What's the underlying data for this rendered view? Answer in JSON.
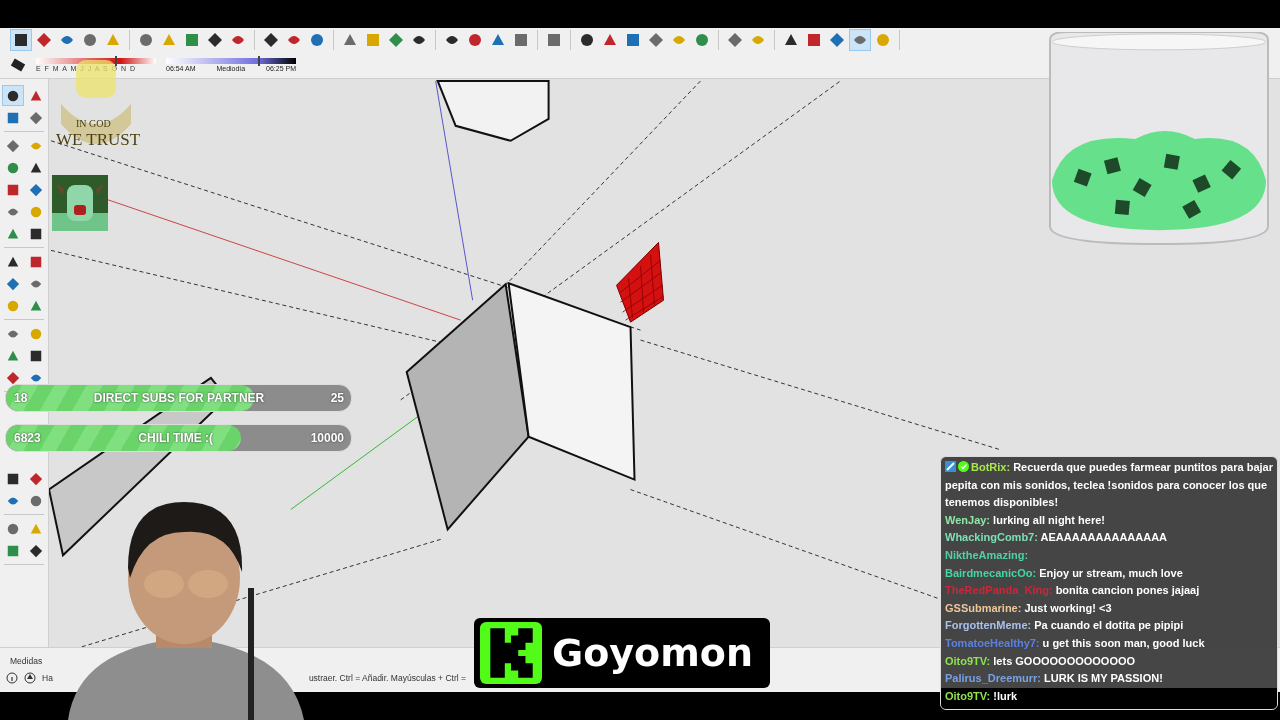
{
  "toolbar": {
    "groups": [
      [
        {
          "selected": true
        },
        {
          "selected": false
        },
        {
          "selected": false
        },
        {
          "selected": false
        },
        {
          "selected": false
        }
      ],
      [
        {
          "selected": false
        },
        {
          "selected": false
        },
        {
          "selected": false
        },
        {
          "selected": false
        },
        {
          "selected": false
        }
      ],
      [
        {
          "selected": false
        },
        {
          "selected": false
        },
        {
          "selected": false
        }
      ],
      [
        {
          "selected": false
        },
        {
          "selected": false
        },
        {
          "selected": false
        },
        {
          "selected": false
        }
      ],
      [
        {
          "selected": false
        },
        {
          "selected": false
        },
        {
          "selected": false
        },
        {
          "selected": false
        }
      ],
      [
        {
          "selected": false
        }
      ],
      [
        {
          "selected": false
        },
        {
          "selected": false
        },
        {
          "selected": false
        },
        {
          "selected": false
        },
        {
          "selected": false
        },
        {
          "selected": false
        }
      ],
      [
        {
          "selected": false
        },
        {
          "selected": false
        }
      ],
      [
        {
          "selected": false
        },
        {
          "selected": false
        },
        {
          "selected": false
        },
        {
          "selected": true
        },
        {
          "selected": false
        }
      ]
    ]
  },
  "shadow_settings": {
    "month_slider": {
      "label": "E F M A M J J A S O N D",
      "level": 0.66
    },
    "time_slider": {
      "start": "06:54 AM",
      "middle": "Mediodía",
      "end": "06:25 PM",
      "level": 0.71
    }
  },
  "left_toolbar": {
    "groups": [
      [
        {
          "selected": true
        },
        {
          "selected": false
        },
        {
          "selected": false
        },
        {
          "selected": false
        }
      ],
      [
        {
          "selected": false
        },
        {
          "selected": false
        },
        {
          "selected": false
        },
        {
          "selected": false
        },
        {
          "selected": false
        },
        {
          "selected": false
        },
        {
          "selected": false
        },
        {
          "selected": false
        },
        {
          "selected": false
        },
        {
          "selected": false
        }
      ],
      [
        {
          "selected": false
        },
        {
          "selected": false
        },
        {
          "selected": false
        },
        {
          "selected": false
        },
        {
          "selected": false
        },
        {
          "selected": false
        }
      ],
      [
        {
          "selected": false
        },
        {
          "selected": false
        },
        {
          "selected": false
        },
        {
          "selected": false
        },
        {
          "selected": false
        },
        {
          "selected": false
        }
      ],
      [
        {
          "selected": false
        },
        {
          "selected": false
        },
        {
          "selected": false
        },
        {
          "selected": false
        }
      ],
      [
        {
          "selected": false
        },
        {
          "selected": false
        },
        {
          "selected": false
        },
        {
          "selected": false
        }
      ]
    ]
  },
  "status_bar": {
    "measurements_label": "Medidas",
    "hint_start": "Ha",
    "hint_rest": "ustraer. Ctrl = Añadir. Mayúsculas + Ctrl ="
  },
  "emblem": {
    "line1": "IN GOD",
    "line2": "WE TRUST"
  },
  "goals": [
    {
      "current": "18",
      "label": "DIRECT SUBS FOR PARTNER",
      "target": "25",
      "level": 0.72
    },
    {
      "current": "6823",
      "label": "CHILI TIME :(",
      "target": "10000",
      "level": 0.68
    }
  ],
  "streamer_badge": {
    "name": "Goyomon"
  },
  "chat": [
    {
      "user": "BotRix:",
      "color": "#a6e84e",
      "bot": true,
      "text": "Recuerda que puedes farmear puntitos para bajar pepita con mis sonidos, teclea !sonidos para conocer los que tenemos disponibles!",
      "highlighted": false
    },
    {
      "user": "WenJay:",
      "color": "#8ee8a8",
      "bot": false,
      "text": "lurking all night here!",
      "highlighted": false
    },
    {
      "user": "WhackingComb7:",
      "color": "#7ee0b4",
      "bot": false,
      "text": "AEAAAAAAAAAAAAAA",
      "highlighted": false
    },
    {
      "user": "NiktheAmazing:",
      "color": "#52d0a4",
      "bot": false,
      "highlighted": false
    },
    {
      "user": "BairdmecanicOo:",
      "color": "#46d6a0",
      "bot": false,
      "text": "Enjoy ur stream, much love",
      "highlighted": false
    },
    {
      "user": "TheRedPanda_King:",
      "color": "#c8283c",
      "bot": false,
      "text": "bonita cancion pones jajaaj",
      "highlighted": false
    },
    {
      "user": "GSSubmarine:",
      "color": "#ecc898",
      "bot": false,
      "text": "Just working! <3",
      "highlighted": false
    },
    {
      "user": "ForgottenMeme:",
      "color": "#a8c0ec",
      "bot": false,
      "text": "Pa cuando el dotita pe pipipi",
      "highlighted": false
    },
    {
      "user": "TomatoeHealthy7:",
      "color": "#5a80e4",
      "bot": false,
      "text": "u get this soon man, good luck",
      "highlighted": false
    },
    {
      "user": "Oito9TV:",
      "color": "#8ee450",
      "bot": false,
      "text": "lets GOOOOOOOOOOOOO",
      "highlighted": false
    },
    {
      "user": "Palirus_Dreemurr:",
      "color": "#7aa0e4",
      "bot": false,
      "text": "LURK IS MY PASSION!",
      "highlighted": false
    },
    {
      "user": "Oito9TV:",
      "color": "#8ee450",
      "bot": false,
      "text": "!lurk",
      "highlighted": true
    }
  ]
}
